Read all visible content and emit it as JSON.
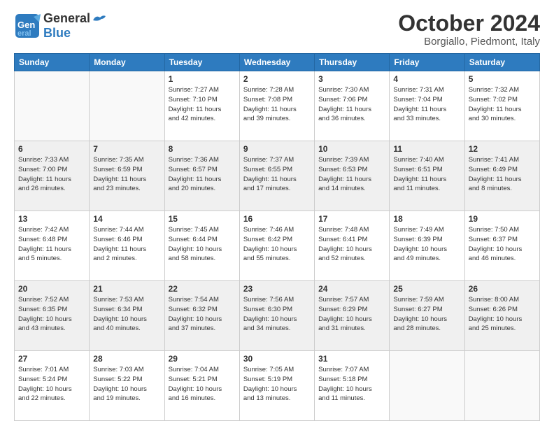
{
  "header": {
    "logo_line1": "General",
    "logo_line2": "Blue",
    "month_title": "October 2024",
    "location": "Borgiallo, Piedmont, Italy"
  },
  "weekdays": [
    "Sunday",
    "Monday",
    "Tuesday",
    "Wednesday",
    "Thursday",
    "Friday",
    "Saturday"
  ],
  "rows": [
    {
      "shaded": false,
      "cells": [
        {
          "day": "",
          "info": ""
        },
        {
          "day": "",
          "info": ""
        },
        {
          "day": "1",
          "info": "Sunrise: 7:27 AM\nSunset: 7:10 PM\nDaylight: 11 hours\nand 42 minutes."
        },
        {
          "day": "2",
          "info": "Sunrise: 7:28 AM\nSunset: 7:08 PM\nDaylight: 11 hours\nand 39 minutes."
        },
        {
          "day": "3",
          "info": "Sunrise: 7:30 AM\nSunset: 7:06 PM\nDaylight: 11 hours\nand 36 minutes."
        },
        {
          "day": "4",
          "info": "Sunrise: 7:31 AM\nSunset: 7:04 PM\nDaylight: 11 hours\nand 33 minutes."
        },
        {
          "day": "5",
          "info": "Sunrise: 7:32 AM\nSunset: 7:02 PM\nDaylight: 11 hours\nand 30 minutes."
        }
      ]
    },
    {
      "shaded": true,
      "cells": [
        {
          "day": "6",
          "info": "Sunrise: 7:33 AM\nSunset: 7:00 PM\nDaylight: 11 hours\nand 26 minutes."
        },
        {
          "day": "7",
          "info": "Sunrise: 7:35 AM\nSunset: 6:59 PM\nDaylight: 11 hours\nand 23 minutes."
        },
        {
          "day": "8",
          "info": "Sunrise: 7:36 AM\nSunset: 6:57 PM\nDaylight: 11 hours\nand 20 minutes."
        },
        {
          "day": "9",
          "info": "Sunrise: 7:37 AM\nSunset: 6:55 PM\nDaylight: 11 hours\nand 17 minutes."
        },
        {
          "day": "10",
          "info": "Sunrise: 7:39 AM\nSunset: 6:53 PM\nDaylight: 11 hours\nand 14 minutes."
        },
        {
          "day": "11",
          "info": "Sunrise: 7:40 AM\nSunset: 6:51 PM\nDaylight: 11 hours\nand 11 minutes."
        },
        {
          "day": "12",
          "info": "Sunrise: 7:41 AM\nSunset: 6:49 PM\nDaylight: 11 hours\nand 8 minutes."
        }
      ]
    },
    {
      "shaded": false,
      "cells": [
        {
          "day": "13",
          "info": "Sunrise: 7:42 AM\nSunset: 6:48 PM\nDaylight: 11 hours\nand 5 minutes."
        },
        {
          "day": "14",
          "info": "Sunrise: 7:44 AM\nSunset: 6:46 PM\nDaylight: 11 hours\nand 2 minutes."
        },
        {
          "day": "15",
          "info": "Sunrise: 7:45 AM\nSunset: 6:44 PM\nDaylight: 10 hours\nand 58 minutes."
        },
        {
          "day": "16",
          "info": "Sunrise: 7:46 AM\nSunset: 6:42 PM\nDaylight: 10 hours\nand 55 minutes."
        },
        {
          "day": "17",
          "info": "Sunrise: 7:48 AM\nSunset: 6:41 PM\nDaylight: 10 hours\nand 52 minutes."
        },
        {
          "day": "18",
          "info": "Sunrise: 7:49 AM\nSunset: 6:39 PM\nDaylight: 10 hours\nand 49 minutes."
        },
        {
          "day": "19",
          "info": "Sunrise: 7:50 AM\nSunset: 6:37 PM\nDaylight: 10 hours\nand 46 minutes."
        }
      ]
    },
    {
      "shaded": true,
      "cells": [
        {
          "day": "20",
          "info": "Sunrise: 7:52 AM\nSunset: 6:35 PM\nDaylight: 10 hours\nand 43 minutes."
        },
        {
          "day": "21",
          "info": "Sunrise: 7:53 AM\nSunset: 6:34 PM\nDaylight: 10 hours\nand 40 minutes."
        },
        {
          "day": "22",
          "info": "Sunrise: 7:54 AM\nSunset: 6:32 PM\nDaylight: 10 hours\nand 37 minutes."
        },
        {
          "day": "23",
          "info": "Sunrise: 7:56 AM\nSunset: 6:30 PM\nDaylight: 10 hours\nand 34 minutes."
        },
        {
          "day": "24",
          "info": "Sunrise: 7:57 AM\nSunset: 6:29 PM\nDaylight: 10 hours\nand 31 minutes."
        },
        {
          "day": "25",
          "info": "Sunrise: 7:59 AM\nSunset: 6:27 PM\nDaylight: 10 hours\nand 28 minutes."
        },
        {
          "day": "26",
          "info": "Sunrise: 8:00 AM\nSunset: 6:26 PM\nDaylight: 10 hours\nand 25 minutes."
        }
      ]
    },
    {
      "shaded": false,
      "cells": [
        {
          "day": "27",
          "info": "Sunrise: 7:01 AM\nSunset: 5:24 PM\nDaylight: 10 hours\nand 22 minutes."
        },
        {
          "day": "28",
          "info": "Sunrise: 7:03 AM\nSunset: 5:22 PM\nDaylight: 10 hours\nand 19 minutes."
        },
        {
          "day": "29",
          "info": "Sunrise: 7:04 AM\nSunset: 5:21 PM\nDaylight: 10 hours\nand 16 minutes."
        },
        {
          "day": "30",
          "info": "Sunrise: 7:05 AM\nSunset: 5:19 PM\nDaylight: 10 hours\nand 13 minutes."
        },
        {
          "day": "31",
          "info": "Sunrise: 7:07 AM\nSunset: 5:18 PM\nDaylight: 10 hours\nand 11 minutes."
        },
        {
          "day": "",
          "info": ""
        },
        {
          "day": "",
          "info": ""
        }
      ]
    }
  ]
}
